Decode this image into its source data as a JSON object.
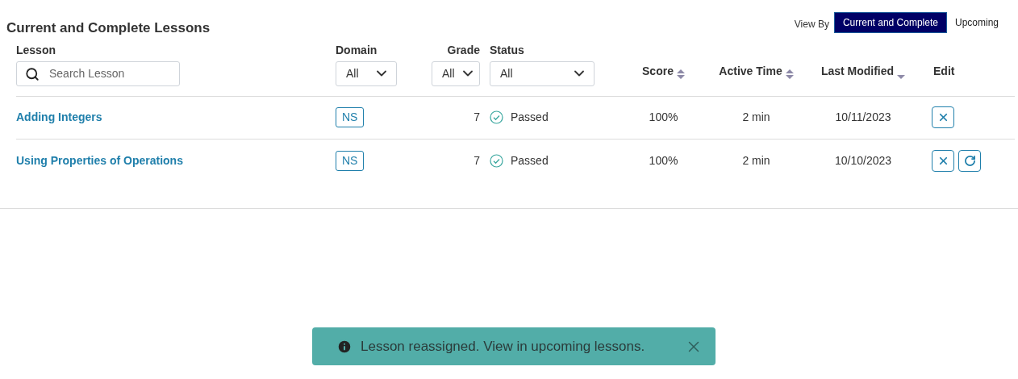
{
  "title": "Current and Complete Lessons",
  "view_by": {
    "label": "View By",
    "options": [
      {
        "label": "Current and Complete",
        "selected": true
      },
      {
        "label": "Upcoming",
        "selected": false
      }
    ]
  },
  "filters": {
    "lesson": {
      "label": "Lesson",
      "placeholder": "Search Lesson"
    },
    "domain": {
      "label": "Domain",
      "value": "All"
    },
    "grade": {
      "label": "Grade",
      "value": "All"
    },
    "status": {
      "label": "Status",
      "value": "All"
    }
  },
  "sort_columns": [
    {
      "label": "Score",
      "kind": "sortable"
    },
    {
      "label": "Active Time",
      "kind": "sortable"
    },
    {
      "label": "Last Modified",
      "kind": "descending"
    }
  ],
  "edit_label": "Edit",
  "rows": [
    {
      "lesson": "Adding Integers",
      "domain": "NS",
      "grade": "7",
      "status": "Passed",
      "score": "100%",
      "active_time": "2 min",
      "last_modified": "10/11/2023",
      "actions": [
        {
          "kind": "remove"
        }
      ]
    },
    {
      "lesson": "Using Properties of Operations",
      "domain": "NS",
      "grade": "7",
      "status": "Passed",
      "score": "100%",
      "active_time": "2 min",
      "last_modified": "10/10/2023",
      "actions": [
        {
          "kind": "remove"
        },
        {
          "kind": "reassign"
        }
      ]
    }
  ],
  "toast": {
    "message": "Lesson reassigned. View in upcoming lessons."
  }
}
